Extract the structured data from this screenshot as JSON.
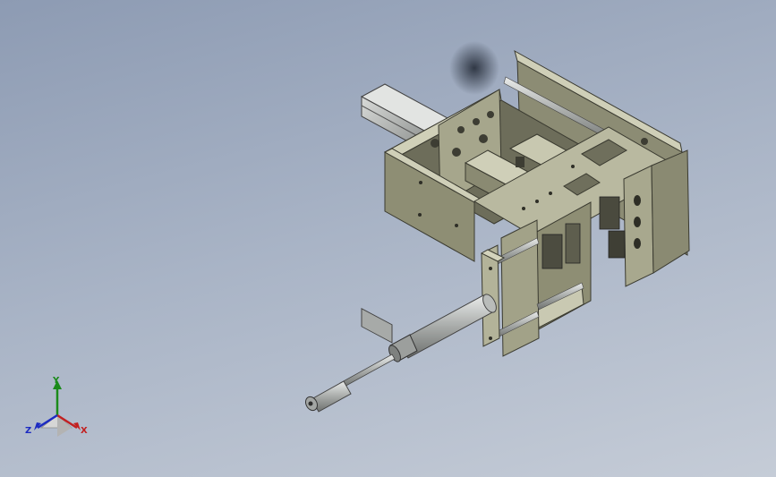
{
  "viewport": {
    "background_top": "#8d9bb3",
    "background_bottom": "#c5ccd7"
  },
  "model": {
    "kind": "cad-assembly-cylinder-mechanism",
    "body_color": "#9e9e84",
    "rail_color": "#c6c8c6"
  },
  "triad": {
    "x_label": "X",
    "y_label": "Y",
    "z_label": "Z",
    "x_color": "#c22020",
    "y_color": "#1a8a1a",
    "z_color": "#1c2bc2"
  }
}
